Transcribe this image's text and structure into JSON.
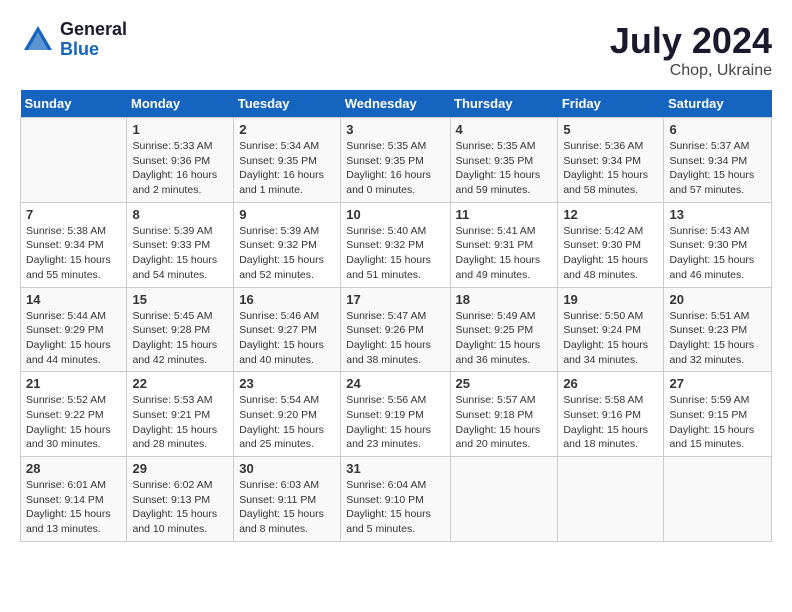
{
  "header": {
    "logo_general": "General",
    "logo_blue": "Blue",
    "title": "July 2024",
    "subtitle": "Chop, Ukraine"
  },
  "days_of_week": [
    "Sunday",
    "Monday",
    "Tuesday",
    "Wednesday",
    "Thursday",
    "Friday",
    "Saturday"
  ],
  "weeks": [
    [
      {
        "day": "",
        "content": ""
      },
      {
        "day": "1",
        "content": "Sunrise: 5:33 AM\nSunset: 9:36 PM\nDaylight: 16 hours\nand 2 minutes."
      },
      {
        "day": "2",
        "content": "Sunrise: 5:34 AM\nSunset: 9:35 PM\nDaylight: 16 hours\nand 1 minute."
      },
      {
        "day": "3",
        "content": "Sunrise: 5:35 AM\nSunset: 9:35 PM\nDaylight: 16 hours\nand 0 minutes."
      },
      {
        "day": "4",
        "content": "Sunrise: 5:35 AM\nSunset: 9:35 PM\nDaylight: 15 hours\nand 59 minutes."
      },
      {
        "day": "5",
        "content": "Sunrise: 5:36 AM\nSunset: 9:34 PM\nDaylight: 15 hours\nand 58 minutes."
      },
      {
        "day": "6",
        "content": "Sunrise: 5:37 AM\nSunset: 9:34 PM\nDaylight: 15 hours\nand 57 minutes."
      }
    ],
    [
      {
        "day": "7",
        "content": "Sunrise: 5:38 AM\nSunset: 9:34 PM\nDaylight: 15 hours\nand 55 minutes."
      },
      {
        "day": "8",
        "content": "Sunrise: 5:39 AM\nSunset: 9:33 PM\nDaylight: 15 hours\nand 54 minutes."
      },
      {
        "day": "9",
        "content": "Sunrise: 5:39 AM\nSunset: 9:32 PM\nDaylight: 15 hours\nand 52 minutes."
      },
      {
        "day": "10",
        "content": "Sunrise: 5:40 AM\nSunset: 9:32 PM\nDaylight: 15 hours\nand 51 minutes."
      },
      {
        "day": "11",
        "content": "Sunrise: 5:41 AM\nSunset: 9:31 PM\nDaylight: 15 hours\nand 49 minutes."
      },
      {
        "day": "12",
        "content": "Sunrise: 5:42 AM\nSunset: 9:30 PM\nDaylight: 15 hours\nand 48 minutes."
      },
      {
        "day": "13",
        "content": "Sunrise: 5:43 AM\nSunset: 9:30 PM\nDaylight: 15 hours\nand 46 minutes."
      }
    ],
    [
      {
        "day": "14",
        "content": "Sunrise: 5:44 AM\nSunset: 9:29 PM\nDaylight: 15 hours\nand 44 minutes."
      },
      {
        "day": "15",
        "content": "Sunrise: 5:45 AM\nSunset: 9:28 PM\nDaylight: 15 hours\nand 42 minutes."
      },
      {
        "day": "16",
        "content": "Sunrise: 5:46 AM\nSunset: 9:27 PM\nDaylight: 15 hours\nand 40 minutes."
      },
      {
        "day": "17",
        "content": "Sunrise: 5:47 AM\nSunset: 9:26 PM\nDaylight: 15 hours\nand 38 minutes."
      },
      {
        "day": "18",
        "content": "Sunrise: 5:49 AM\nSunset: 9:25 PM\nDaylight: 15 hours\nand 36 minutes."
      },
      {
        "day": "19",
        "content": "Sunrise: 5:50 AM\nSunset: 9:24 PM\nDaylight: 15 hours\nand 34 minutes."
      },
      {
        "day": "20",
        "content": "Sunrise: 5:51 AM\nSunset: 9:23 PM\nDaylight: 15 hours\nand 32 minutes."
      }
    ],
    [
      {
        "day": "21",
        "content": "Sunrise: 5:52 AM\nSunset: 9:22 PM\nDaylight: 15 hours\nand 30 minutes."
      },
      {
        "day": "22",
        "content": "Sunrise: 5:53 AM\nSunset: 9:21 PM\nDaylight: 15 hours\nand 28 minutes."
      },
      {
        "day": "23",
        "content": "Sunrise: 5:54 AM\nSunset: 9:20 PM\nDaylight: 15 hours\nand 25 minutes."
      },
      {
        "day": "24",
        "content": "Sunrise: 5:56 AM\nSunset: 9:19 PM\nDaylight: 15 hours\nand 23 minutes."
      },
      {
        "day": "25",
        "content": "Sunrise: 5:57 AM\nSunset: 9:18 PM\nDaylight: 15 hours\nand 20 minutes."
      },
      {
        "day": "26",
        "content": "Sunrise: 5:58 AM\nSunset: 9:16 PM\nDaylight: 15 hours\nand 18 minutes."
      },
      {
        "day": "27",
        "content": "Sunrise: 5:59 AM\nSunset: 9:15 PM\nDaylight: 15 hours\nand 15 minutes."
      }
    ],
    [
      {
        "day": "28",
        "content": "Sunrise: 6:01 AM\nSunset: 9:14 PM\nDaylight: 15 hours\nand 13 minutes."
      },
      {
        "day": "29",
        "content": "Sunrise: 6:02 AM\nSunset: 9:13 PM\nDaylight: 15 hours\nand 10 minutes."
      },
      {
        "day": "30",
        "content": "Sunrise: 6:03 AM\nSunset: 9:11 PM\nDaylight: 15 hours\nand 8 minutes."
      },
      {
        "day": "31",
        "content": "Sunrise: 6:04 AM\nSunset: 9:10 PM\nDaylight: 15 hours\nand 5 minutes."
      },
      {
        "day": "",
        "content": ""
      },
      {
        "day": "",
        "content": ""
      },
      {
        "day": "",
        "content": ""
      }
    ]
  ]
}
